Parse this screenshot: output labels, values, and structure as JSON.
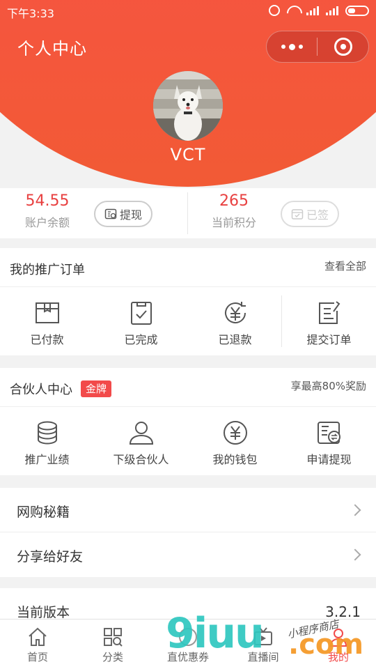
{
  "status_bar": {
    "time": "下午3:33"
  },
  "header": {
    "title": "个人中心",
    "username": "VCT"
  },
  "stats": {
    "balance": {
      "value": "54.55",
      "label": "账户余额",
      "button": "提现"
    },
    "points": {
      "value": "265",
      "label": "当前积分",
      "button": "已签"
    }
  },
  "orders": {
    "title": "我的推广订单",
    "view_all": "查看全部",
    "items": [
      {
        "label": "已付款",
        "icon": "box-icon"
      },
      {
        "label": "已完成",
        "icon": "clipboard-check-icon"
      },
      {
        "label": "已退款",
        "icon": "yuan-refund-icon"
      },
      {
        "label": "提交订单",
        "icon": "edit-document-icon"
      }
    ]
  },
  "partner": {
    "title": "合伙人中心",
    "badge": "金牌",
    "promo": "享最高80%奖励",
    "items": [
      {
        "label": "推广业绩",
        "icon": "coin-stack-icon"
      },
      {
        "label": "下级合伙人",
        "icon": "user-icon"
      },
      {
        "label": "我的钱包",
        "icon": "yuan-circle-icon"
      },
      {
        "label": "申请提现",
        "icon": "withdraw-icon"
      }
    ]
  },
  "links": [
    {
      "label": "网购秘籍"
    },
    {
      "label": "分享给好友"
    }
  ],
  "version": {
    "label": "当前版本",
    "value": "3.2.1"
  },
  "tabbar": [
    {
      "label": "首页",
      "icon": "home-icon"
    },
    {
      "label": "分类",
      "icon": "category-icon"
    },
    {
      "label": "直优惠券",
      "icon": "coupon-icon"
    },
    {
      "label": "直播间",
      "icon": "tv-icon"
    },
    {
      "label": "我的",
      "icon": "profile-icon"
    }
  ],
  "watermark": {
    "main": "9iuu",
    "com": ".com",
    "small": "小程序商店"
  },
  "colors": {
    "brand_red": "#f24a4a",
    "accent_text": "#e84040",
    "watermark_teal": "#2fc7c0",
    "watermark_orange": "#f59a2a"
  }
}
